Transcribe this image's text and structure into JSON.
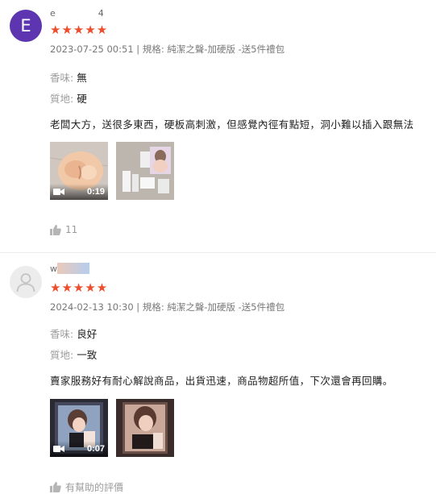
{
  "reviews": [
    {
      "avatar_letter": "E",
      "username_start": "e",
      "username_end": "4",
      "stars": "★★★★★",
      "date": "2023-07-25 00:51",
      "variation": "| 規格: 純潔之聲-加硬版 -送5件禮包",
      "attr1_label": "香味: ",
      "attr1_value": "無",
      "attr2_label": "質地: ",
      "attr2_value": "硬",
      "comment": "老闆大方，送很多東西，硬板高刺激，但感覺內徑有點短，洞小難以插入跟無法",
      "media": [
        {
          "type": "video",
          "duration": "0:19"
        },
        {
          "type": "image"
        }
      ],
      "likes": "11"
    },
    {
      "username_start": "w",
      "stars": "★★★★★",
      "date": "2024-02-13 10:30",
      "variation": "| 規格: 純潔之聲-加硬版 -送5件禮包",
      "attr1_label": "香味: ",
      "attr1_value": "良好",
      "attr2_label": "質地: ",
      "attr2_value": "一致",
      "comment": "賣家服務好有耐心解說商品，出貨迅速，商品物超所值，下次還會再回購。",
      "media": [
        {
          "type": "video",
          "duration": "0:07"
        },
        {
          "type": "image"
        }
      ],
      "helpful_label": "有幫助的評價"
    }
  ],
  "colors": {
    "star": "#ee4d2d",
    "avatar": "#5e35b1"
  }
}
